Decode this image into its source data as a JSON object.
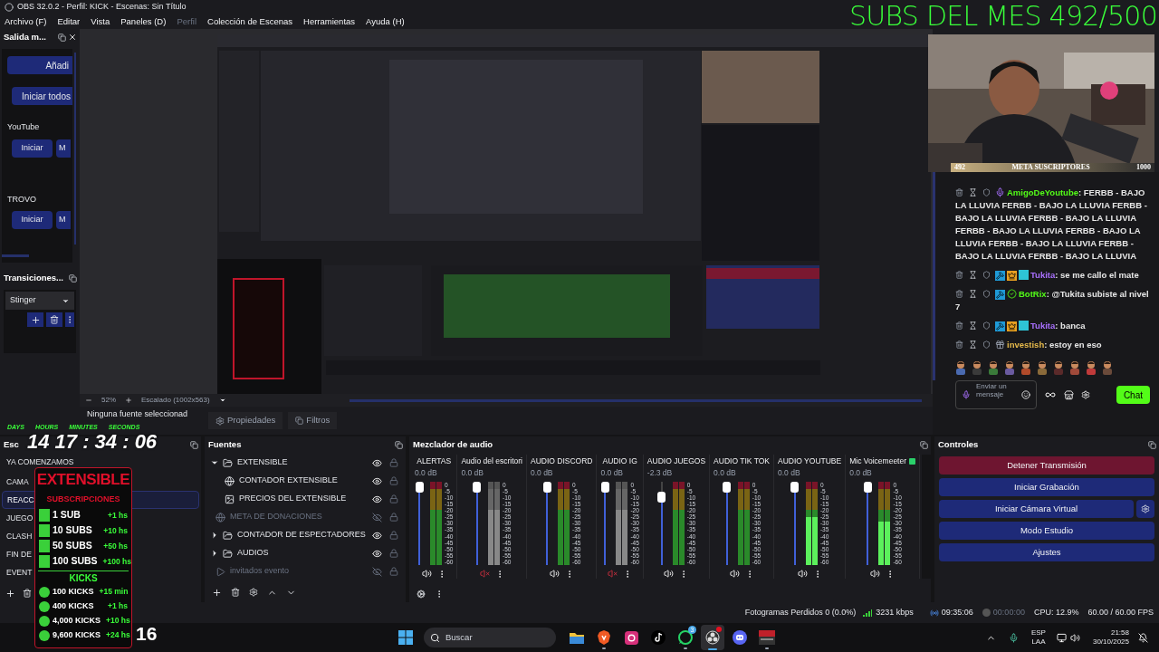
{
  "window": {
    "title": "OBS 32.0.2 - Perfil: KICK - Escenas: Sin Título"
  },
  "menu": [
    {
      "label": "Archivo (F)",
      "disabled": false
    },
    {
      "label": "Editar",
      "disabled": false
    },
    {
      "label": "Vista",
      "disabled": false
    },
    {
      "label": "Paneles (D)",
      "disabled": false
    },
    {
      "label": "Perfil",
      "disabled": true
    },
    {
      "label": "Colección de Escenas",
      "disabled": false
    },
    {
      "label": "Herramientas",
      "disabled": false
    },
    {
      "label": "Ayuda (H)",
      "disabled": false
    }
  ],
  "output_dock": {
    "title": "Salida m...",
    "add_button": "Añadi",
    "start_all_button": "Iniciar todos",
    "services": [
      {
        "name": "YouTube",
        "start_button": "Iniciar",
        "second_button": "M"
      },
      {
        "name": "TROVO",
        "start_button": "Iniciar",
        "second_button": "M"
      }
    ]
  },
  "transitions_dock": {
    "title": "Transiciones...",
    "transition": "Stinger"
  },
  "preview": {
    "zoom": "52%",
    "scaling": "Escalado (1002x563)"
  },
  "source_bar": {
    "status": "Ninguna fuente seleccionad",
    "properties_button": "Propiedades",
    "filters_button": "Filtros"
  },
  "overlay": {
    "subs_goal": "SUBS DEL MES 492/500",
    "meta": {
      "current": "492",
      "label": "META SUSCRIPTORES",
      "target": "1000"
    },
    "timer": {
      "labels": [
        "DAYS",
        "HOURS",
        "MINUTES",
        "SECONDS"
      ],
      "value": "14 17 : 34 : 06"
    },
    "card": {
      "title": "EXTENSIBLE",
      "subs_heading": "SUBSCRIPCIONES",
      "subs": [
        {
          "label": "1 SUB",
          "reward": "+1 hs"
        },
        {
          "label": "10 SUBS",
          "reward": "+10 hs"
        },
        {
          "label": "50 SUBS",
          "reward": "+50 hs"
        },
        {
          "label": "100 SUBS",
          "reward": "+100 hs"
        }
      ],
      "kicks_heading": "KICKS",
      "kicks": [
        {
          "label": "100 KICKS",
          "reward": "+15 min"
        },
        {
          "label": "400 KICKS",
          "reward": "+1 hs"
        },
        {
          "label": "4,000 KICKS",
          "reward": "+10 hs"
        },
        {
          "label": "9,600 KICKS",
          "reward": "+24 hs"
        }
      ]
    },
    "counter": "16"
  },
  "chat": {
    "messages": [
      {
        "user": "AmigoDeYoutube",
        "color": "#53fc18",
        "badges": [
          {
            "kind": "mic"
          }
        ],
        "text": ": FERBB - BAJO LA LLUVIA FERBB - BAJO LA LLUVIA FERBB - BAJO LA LLUVIA FERBB - BAJO LA LLUVIA FERBB - BAJO LA LLUVIA FERBB - BAJO LA LLUVIA FERBB - BAJO LA LLUVIA FERBB - BAJO LA LLUVIA FERBB - BAJO LA LLUVIA"
      },
      {
        "user": "Tukita",
        "color": "#a970ff",
        "badges": [
          {
            "kind": "moderator"
          },
          {
            "kind": "founder"
          },
          {
            "kind": "subscriber"
          }
        ],
        "text": ": se me callo el mate"
      },
      {
        "user": "BotRix",
        "color": "#53fc18",
        "badges": [
          {
            "kind": "moderator"
          },
          {
            "kind": "verified"
          }
        ],
        "text": ": @Tukita subiste al nivel 7"
      },
      {
        "user": "Tukita",
        "color": "#a970ff",
        "badges": [
          {
            "kind": "moderator"
          },
          {
            "kind": "founder"
          },
          {
            "kind": "subscriber"
          }
        ],
        "text": ": banca"
      },
      {
        "user": "investish",
        "color": "#e5b94b",
        "badges": [
          {
            "kind": "gifter"
          }
        ],
        "text": ": estoy en eso"
      }
    ],
    "input_placeholder": "Enviar un mensaje",
    "send_button": "Chat"
  },
  "scenes": {
    "title": "Esc",
    "items": [
      {
        "label": "YA COMENZAMOS",
        "selected": false
      },
      {
        "label": "CAMA",
        "selected": false
      },
      {
        "label": "REACC",
        "selected": true
      },
      {
        "label": "JUEGO",
        "selected": false
      },
      {
        "label": "CLASH",
        "selected": false
      },
      {
        "label": "FIN DE",
        "selected": false
      },
      {
        "label": "EVENT",
        "selected": false
      }
    ]
  },
  "sources": {
    "title": "Fuentes",
    "items": [
      {
        "name": "EXTENSIBLE",
        "kind": "group",
        "expanded": true,
        "visible": true,
        "children": [
          {
            "name": "CONTADOR EXTENSIBLE",
            "kind": "browser",
            "visible": true
          },
          {
            "name": "PRECIOS DEL EXTENSIBLE",
            "visible": true
          }
        ]
      },
      {
        "name": "META DE DONACIONES",
        "kind": "browser",
        "visible": false
      },
      {
        "name": "CONTADOR DE ESPECTADORES",
        "kind": "group",
        "expanded": false,
        "visible": true
      },
      {
        "name": "AUDIOS",
        "kind": "group",
        "expanded": false,
        "visible": true
      },
      {
        "name": "invitados evento",
        "kind": "media",
        "visible": false
      }
    ]
  },
  "mixer": {
    "title": "Mezclador de audio",
    "channels": [
      {
        "name": "ALERTAS",
        "reading": "0.0 dB",
        "muted": false,
        "level": 1,
        "meter": {
          "level": 0
        },
        "scale": [
          "0",
          "-5",
          "-10",
          "-15",
          "-20",
          "-25",
          "-30",
          "-35",
          "-40",
          "-45",
          "-50",
          "-55",
          "-60"
        ]
      },
      {
        "name": "Audio del escritori",
        "reading": "0.0 dB",
        "muted": true,
        "level": 1,
        "meter": {
          "level": 0
        },
        "scale": [
          "0",
          "-5",
          "-10",
          "-15",
          "-20",
          "-25",
          "-30",
          "-35",
          "-40",
          "-45",
          "-50",
          "-55",
          "-60"
        ]
      },
      {
        "name": "AUDIO DISCORD",
        "reading": "0.0 dB",
        "muted": false,
        "level": 1,
        "meter": {
          "level": 0
        },
        "scale": [
          "0",
          "-5",
          "-10",
          "-15",
          "-20",
          "-25",
          "-30",
          "-35",
          "-40",
          "-45",
          "-50",
          "-55",
          "-60"
        ]
      },
      {
        "name": "AUDIO IG",
        "reading": "0.0 dB",
        "muted": true,
        "level": 1,
        "meter": {
          "level": 0
        },
        "scale": [
          "0",
          "-5",
          "-10",
          "-15",
          "-20",
          "-25",
          "-30",
          "-35",
          "-40",
          "-45",
          "-50",
          "-55",
          "-60"
        ]
      },
      {
        "name": "AUDIO JUEGOS",
        "reading": "-2.3 dB",
        "muted": false,
        "level": 0.86,
        "meter": {
          "level": 0
        },
        "scale": [
          "0",
          "-5",
          "-10",
          "-15",
          "-20",
          "-25",
          "-30",
          "-35",
          "-40",
          "-45",
          "-50",
          "-55",
          "-60"
        ]
      },
      {
        "name": "AUDIO TIK TOK",
        "reading": "0.0 dB",
        "muted": false,
        "level": 1,
        "meter": {
          "level": 0
        },
        "scale": [
          "0",
          "-5",
          "-10",
          "-15",
          "-20",
          "-25",
          "-30",
          "-35",
          "-40",
          "-45",
          "-50",
          "-55",
          "-60"
        ]
      },
      {
        "name": "AUDIO YOUTUBE",
        "reading": "0.0 dB",
        "muted": false,
        "level": 1,
        "meter": {
          "level": 0.58
        },
        "scale": [
          "0",
          "-5",
          "-10",
          "-15",
          "-20",
          "-25",
          "-30",
          "-35",
          "-40",
          "-45",
          "-50",
          "-55",
          "-60"
        ]
      },
      {
        "name": "Mic Voicemeeter",
        "kind": "mic",
        "reading": "0.0 dB",
        "muted": false,
        "level": 1,
        "meter": {
          "level": 0.52
        },
        "scale": [
          "0",
          "-5",
          "-10",
          "-15",
          "-20",
          "-25",
          "-30",
          "-35",
          "-40",
          "-45",
          "-50",
          "-55",
          "-60"
        ]
      }
    ]
  },
  "controls": {
    "title": "Controles",
    "buttons": [
      {
        "label": "Detener Transmisión",
        "kind": "stop"
      },
      {
        "label": "Iniciar Grabación",
        "kind": "normal"
      },
      {
        "label": "Iniciar Cámara Virtual",
        "kind": "virtualcam"
      },
      {
        "label": "Modo Estudio",
        "kind": "normal"
      },
      {
        "label": "Ajustes",
        "kind": "normal"
      }
    ]
  },
  "status_bar": {
    "dropped_frames": "Fotogramas Perdidos 0 (0.0%)",
    "bitrate": "3231 kbps",
    "stream_time": "09:35:06",
    "record_time": "00:00:00",
    "cpu": "CPU: 12.9%",
    "fps": "60.00 / 60.00 FPS"
  },
  "taskbar": {
    "search_placeholder": "Buscar",
    "apps": [
      {
        "kind": "folder",
        "running": false,
        "active": false
      },
      {
        "kind": "brave",
        "running": true,
        "active": false
      },
      {
        "kind": "instagram",
        "running": false,
        "active": false
      },
      {
        "kind": "tiktok",
        "running": false,
        "active": false
      },
      {
        "kind": "whatsapp",
        "running": true,
        "active": false,
        "badge": "3"
      },
      {
        "kind": "obs",
        "running": true,
        "active": true
      },
      {
        "kind": "discord",
        "running": false,
        "active": false
      },
      {
        "kind": "voicemeeter",
        "running": true,
        "active": false
      }
    ],
    "language": "ESP",
    "layout": "LAA",
    "time": "21:58",
    "date": "30/10/2025"
  }
}
